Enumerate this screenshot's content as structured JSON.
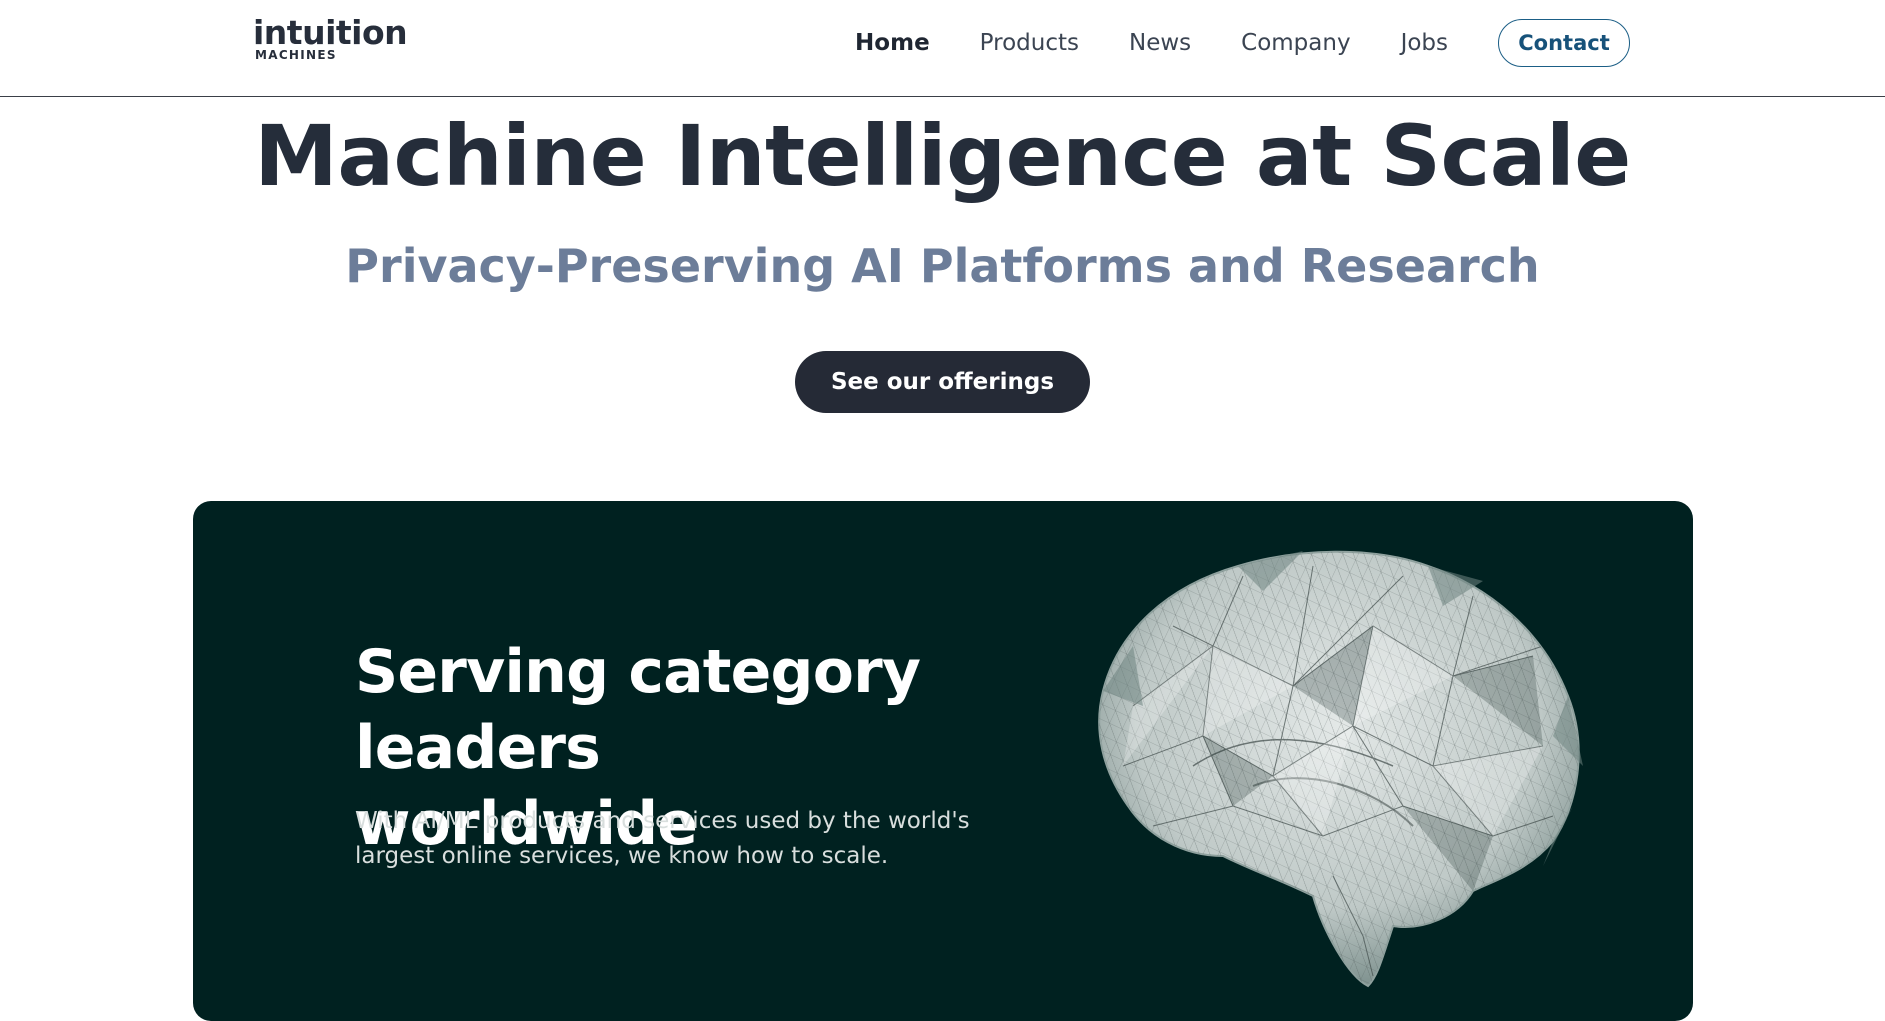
{
  "brand": {
    "name": "intuition",
    "sub": "MACHINES"
  },
  "nav": {
    "items": [
      {
        "label": "Home",
        "active": true
      },
      {
        "label": "Products",
        "active": false
      },
      {
        "label": "News",
        "active": false
      },
      {
        "label": "Company",
        "active": false
      },
      {
        "label": "Jobs",
        "active": false
      }
    ],
    "contact_label": "Contact"
  },
  "hero": {
    "title": "Machine Intelligence at Scale",
    "subtitle": "Privacy-Preserving AI Platforms and Research",
    "cta_label": "See our offerings"
  },
  "feature": {
    "heading_line1": "Serving category",
    "heading_line2": "leaders worldwide",
    "body_line1": "With AI/ML products and services used by the world's",
    "body_line2": "largest online services, we know how to scale.",
    "image_icon": "wireframe-brain-image"
  },
  "colors": {
    "text_dark": "#252d3a",
    "subtitle": "#6c7d99",
    "button_dark": "#252a36",
    "contact_accent": "#17527a",
    "card_bg": "#002120"
  }
}
